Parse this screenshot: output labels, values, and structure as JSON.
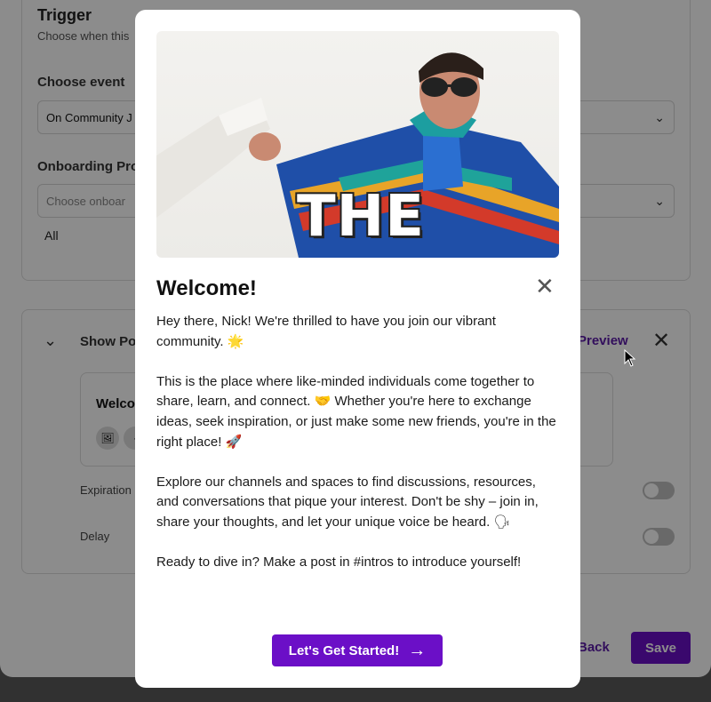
{
  "background": {
    "trigger": {
      "title": "Trigger",
      "subtitle": "Choose when this",
      "event_label": "Choose event",
      "event_value": "On Community J",
      "onboarding_label": "Onboarding Pro",
      "onboarding_placeholder": "Choose onboar",
      "audience_value": "All"
    },
    "popup": {
      "show_label": "Show Po",
      "preview_label": "Preview",
      "welcome_preview_title": "Welco",
      "expiration_label": "Expiration",
      "delay_label": "Delay"
    },
    "footer": {
      "back_label": "Back",
      "save_label": "Save"
    }
  },
  "modal": {
    "hero_caption": "THE",
    "title": "Welcome!",
    "paragraphs": [
      "Hey there, Nick! We're thrilled to have you join our vibrant community. 🌟",
      "This is the place where like-minded individuals come together to share, learn, and connect. 🤝 Whether you're here to exchange ideas, seek inspiration, or just make some new friends, you're in the right place! 🚀",
      "Explore our channels and spaces to find discussions, resources, and conversations that pique your interest. Don't be shy – join in, share your thoughts, and let your unique voice be heard. 🗣",
      "Ready to dive in? Make a post in #intros to introduce yourself!"
    ],
    "cta_label": "Let's Get Started!"
  },
  "colors": {
    "accent": "#6b0fc7",
    "link": "#5b1ba8"
  },
  "icons": {
    "close": "close-icon",
    "arrow": "arrow-right-icon",
    "chevron": "chevron-down-icon"
  }
}
